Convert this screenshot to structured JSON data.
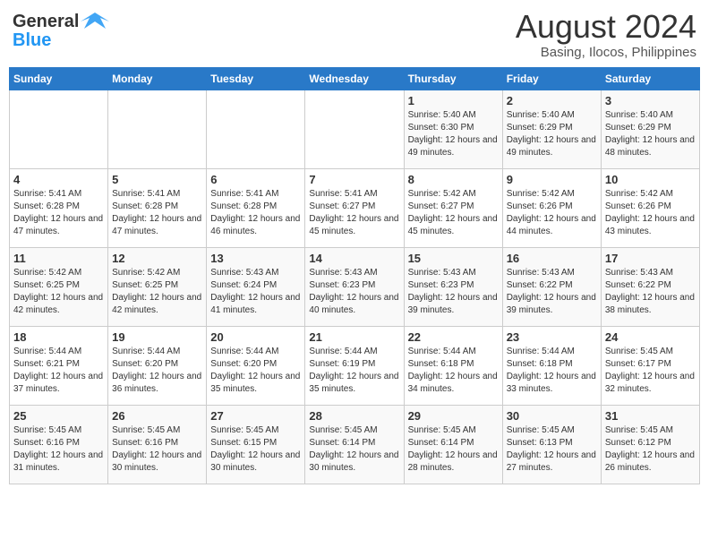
{
  "header": {
    "logo_line1": "General",
    "logo_line2": "Blue",
    "month": "August 2024",
    "location": "Basing, Ilocos, Philippines"
  },
  "weekdays": [
    "Sunday",
    "Monday",
    "Tuesday",
    "Wednesday",
    "Thursday",
    "Friday",
    "Saturday"
  ],
  "weeks": [
    [
      {
        "day": "",
        "sunrise": "",
        "sunset": "",
        "daylight": ""
      },
      {
        "day": "",
        "sunrise": "",
        "sunset": "",
        "daylight": ""
      },
      {
        "day": "",
        "sunrise": "",
        "sunset": "",
        "daylight": ""
      },
      {
        "day": "",
        "sunrise": "",
        "sunset": "",
        "daylight": ""
      },
      {
        "day": "1",
        "sunrise": "Sunrise: 5:40 AM",
        "sunset": "Sunset: 6:30 PM",
        "daylight": "Daylight: 12 hours and 49 minutes."
      },
      {
        "day": "2",
        "sunrise": "Sunrise: 5:40 AM",
        "sunset": "Sunset: 6:29 PM",
        "daylight": "Daylight: 12 hours and 49 minutes."
      },
      {
        "day": "3",
        "sunrise": "Sunrise: 5:40 AM",
        "sunset": "Sunset: 6:29 PM",
        "daylight": "Daylight: 12 hours and 48 minutes."
      }
    ],
    [
      {
        "day": "4",
        "sunrise": "Sunrise: 5:41 AM",
        "sunset": "Sunset: 6:28 PM",
        "daylight": "Daylight: 12 hours and 47 minutes."
      },
      {
        "day": "5",
        "sunrise": "Sunrise: 5:41 AM",
        "sunset": "Sunset: 6:28 PM",
        "daylight": "Daylight: 12 hours and 47 minutes."
      },
      {
        "day": "6",
        "sunrise": "Sunrise: 5:41 AM",
        "sunset": "Sunset: 6:28 PM",
        "daylight": "Daylight: 12 hours and 46 minutes."
      },
      {
        "day": "7",
        "sunrise": "Sunrise: 5:41 AM",
        "sunset": "Sunset: 6:27 PM",
        "daylight": "Daylight: 12 hours and 45 minutes."
      },
      {
        "day": "8",
        "sunrise": "Sunrise: 5:42 AM",
        "sunset": "Sunset: 6:27 PM",
        "daylight": "Daylight: 12 hours and 45 minutes."
      },
      {
        "day": "9",
        "sunrise": "Sunrise: 5:42 AM",
        "sunset": "Sunset: 6:26 PM",
        "daylight": "Daylight: 12 hours and 44 minutes."
      },
      {
        "day": "10",
        "sunrise": "Sunrise: 5:42 AM",
        "sunset": "Sunset: 6:26 PM",
        "daylight": "Daylight: 12 hours and 43 minutes."
      }
    ],
    [
      {
        "day": "11",
        "sunrise": "Sunrise: 5:42 AM",
        "sunset": "Sunset: 6:25 PM",
        "daylight": "Daylight: 12 hours and 42 minutes."
      },
      {
        "day": "12",
        "sunrise": "Sunrise: 5:42 AM",
        "sunset": "Sunset: 6:25 PM",
        "daylight": "Daylight: 12 hours and 42 minutes."
      },
      {
        "day": "13",
        "sunrise": "Sunrise: 5:43 AM",
        "sunset": "Sunset: 6:24 PM",
        "daylight": "Daylight: 12 hours and 41 minutes."
      },
      {
        "day": "14",
        "sunrise": "Sunrise: 5:43 AM",
        "sunset": "Sunset: 6:23 PM",
        "daylight": "Daylight: 12 hours and 40 minutes."
      },
      {
        "day": "15",
        "sunrise": "Sunrise: 5:43 AM",
        "sunset": "Sunset: 6:23 PM",
        "daylight": "Daylight: 12 hours and 39 minutes."
      },
      {
        "day": "16",
        "sunrise": "Sunrise: 5:43 AM",
        "sunset": "Sunset: 6:22 PM",
        "daylight": "Daylight: 12 hours and 39 minutes."
      },
      {
        "day": "17",
        "sunrise": "Sunrise: 5:43 AM",
        "sunset": "Sunset: 6:22 PM",
        "daylight": "Daylight: 12 hours and 38 minutes."
      }
    ],
    [
      {
        "day": "18",
        "sunrise": "Sunrise: 5:44 AM",
        "sunset": "Sunset: 6:21 PM",
        "daylight": "Daylight: 12 hours and 37 minutes."
      },
      {
        "day": "19",
        "sunrise": "Sunrise: 5:44 AM",
        "sunset": "Sunset: 6:20 PM",
        "daylight": "Daylight: 12 hours and 36 minutes."
      },
      {
        "day": "20",
        "sunrise": "Sunrise: 5:44 AM",
        "sunset": "Sunset: 6:20 PM",
        "daylight": "Daylight: 12 hours and 35 minutes."
      },
      {
        "day": "21",
        "sunrise": "Sunrise: 5:44 AM",
        "sunset": "Sunset: 6:19 PM",
        "daylight": "Daylight: 12 hours and 35 minutes."
      },
      {
        "day": "22",
        "sunrise": "Sunrise: 5:44 AM",
        "sunset": "Sunset: 6:18 PM",
        "daylight": "Daylight: 12 hours and 34 minutes."
      },
      {
        "day": "23",
        "sunrise": "Sunrise: 5:44 AM",
        "sunset": "Sunset: 6:18 PM",
        "daylight": "Daylight: 12 hours and 33 minutes."
      },
      {
        "day": "24",
        "sunrise": "Sunrise: 5:45 AM",
        "sunset": "Sunset: 6:17 PM",
        "daylight": "Daylight: 12 hours and 32 minutes."
      }
    ],
    [
      {
        "day": "25",
        "sunrise": "Sunrise: 5:45 AM",
        "sunset": "Sunset: 6:16 PM",
        "daylight": "Daylight: 12 hours and 31 minutes."
      },
      {
        "day": "26",
        "sunrise": "Sunrise: 5:45 AM",
        "sunset": "Sunset: 6:16 PM",
        "daylight": "Daylight: 12 hours and 30 minutes."
      },
      {
        "day": "27",
        "sunrise": "Sunrise: 5:45 AM",
        "sunset": "Sunset: 6:15 PM",
        "daylight": "Daylight: 12 hours and 30 minutes."
      },
      {
        "day": "28",
        "sunrise": "Sunrise: 5:45 AM",
        "sunset": "Sunset: 6:14 PM",
        "daylight": "Daylight: 12 hours and 30 minutes."
      },
      {
        "day": "29",
        "sunrise": "Sunrise: 5:45 AM",
        "sunset": "Sunset: 6:14 PM",
        "daylight": "Daylight: 12 hours and 28 minutes."
      },
      {
        "day": "30",
        "sunrise": "Sunrise: 5:45 AM",
        "sunset": "Sunset: 6:13 PM",
        "daylight": "Daylight: 12 hours and 27 minutes."
      },
      {
        "day": "31",
        "sunrise": "Sunrise: 5:45 AM",
        "sunset": "Sunset: 6:12 PM",
        "daylight": "Daylight: 12 hours and 26 minutes."
      }
    ]
  ]
}
